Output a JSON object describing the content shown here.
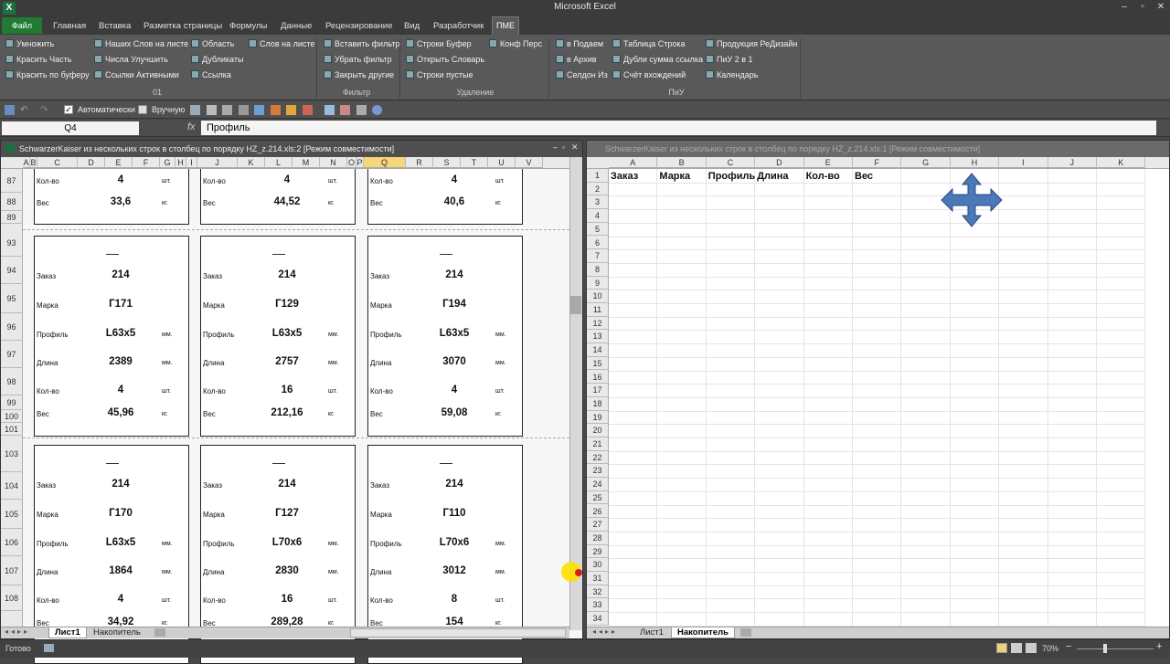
{
  "app": {
    "title": "Microsoft Excel",
    "min_label": "–",
    "max_label": "▫",
    "close_label": "✕"
  },
  "ribbon_tabs": [
    "Главная",
    "Вставка",
    "Разметка страницы",
    "Формулы",
    "Данные",
    "Рецензирование",
    "Вид",
    "Разработчик"
  ],
  "file_tab": "Файл",
  "active_tab": "ПМЕ",
  "ribbon": {
    "col1": [
      "Умножить",
      "Красить Часть",
      "Красить по буферу"
    ],
    "col2": [
      "Наших Слов на листе",
      "Числа Улучшить",
      "Ссылки Активными"
    ],
    "col3": [
      "Область",
      "Дубликаты",
      "Ссылка"
    ],
    "col4": [
      "Слов на листе"
    ],
    "group1": "01",
    "col5": [
      "Вставить фильтр",
      "Убрать фильтр",
      "Закрыть другие"
    ],
    "group2": "Фильтр",
    "col6": [
      "Строки Буфер",
      "Открыть Словарь",
      "Строки пустые"
    ],
    "col7": [
      "Конф Перс"
    ],
    "group3": "Удаление",
    "col8": [
      "в Подаем",
      "в Архив",
      "Селдон Из"
    ],
    "col9": [
      "Таблица Строка",
      "Дубли сумма ссылка",
      "Счёт вхождений"
    ],
    "col10": [
      "Продукция РеДизайн",
      "ПиУ 2 в 1",
      "Календарь"
    ],
    "group4": "ПиУ"
  },
  "qat": {
    "auto_label": "Автоматически",
    "manual_label": "Вручную"
  },
  "formula_bar": {
    "name_box": "Q4",
    "fx": "fx",
    "value": "Профиль"
  },
  "left_window": {
    "title": "SchwarzerKaiser из нескольких строк в столбец по порядку HZ_z.214.xls:2  [Режим совместимости]",
    "columns": [
      "A",
      "B",
      "C",
      "D",
      "E",
      "F",
      "G",
      "H",
      "I",
      "J",
      "K",
      "L",
      "M",
      "N",
      "O",
      "P",
      "Q",
      "R",
      "S",
      "T",
      "U",
      "V"
    ],
    "rows": [
      "87",
      "88",
      "89",
      "93",
      "94",
      "95",
      "96",
      "97",
      "98",
      "99",
      "100",
      "101",
      "103",
      "104",
      "105",
      "106",
      "107",
      "108"
    ],
    "labels": {
      "order": "Заказ",
      "mark": "Марка",
      "profile": "Профиль",
      "length": "Длина",
      "qty": "Кол-во",
      "weight": "Вес"
    },
    "units": {
      "length": "мм.",
      "profile": "мм.",
      "qty": "шт.",
      "weight": "кг."
    },
    "top_cards": [
      {
        "qty": "4",
        "weight": "33,6"
      },
      {
        "qty": "4",
        "weight": "44,52"
      },
      {
        "qty": "4",
        "weight": "40,6"
      }
    ],
    "mid_cards": [
      {
        "order": "214",
        "mark": "Г171",
        "profile": "L63x5",
        "length": "2389",
        "qty": "4",
        "weight": "45,96"
      },
      {
        "order": "214",
        "mark": "Г129",
        "profile": "L63x5",
        "length": "2757",
        "qty": "16",
        "weight": "212,16"
      },
      {
        "order": "214",
        "mark": "Г194",
        "profile": "L63x5",
        "length": "3070",
        "qty": "4",
        "weight": "59,08"
      }
    ],
    "bot_cards": [
      {
        "order": "214",
        "mark": "Г170",
        "profile": "L63x5",
        "length": "1864",
        "qty": "4",
        "weight": "34,92"
      },
      {
        "order": "214",
        "mark": "Г127",
        "profile": "L70x6",
        "length": "2830",
        "qty": "16",
        "weight": "289,28"
      },
      {
        "order": "214",
        "mark": "Г110",
        "profile": "L70x6",
        "length": "3012",
        "qty": "8",
        "weight": "154"
      }
    ],
    "sheets": [
      "Лист1",
      "Накопитель"
    ]
  },
  "right_window": {
    "title": "SchwarzerKaiser из нескольких строк в столбец по порядку HZ_z.214.xls:1  [Режим совместимости]",
    "columns": [
      "A",
      "B",
      "C",
      "D",
      "E",
      "F",
      "G",
      "H",
      "I",
      "J",
      "K"
    ],
    "headers": [
      "Заказ",
      "Марка",
      "Профиль",
      "Длина",
      "Кол-во",
      "Вес"
    ],
    "sheets": [
      "Лист1",
      "Накопитель"
    ]
  },
  "status": {
    "ready": "Готово",
    "zoom": "70%"
  }
}
